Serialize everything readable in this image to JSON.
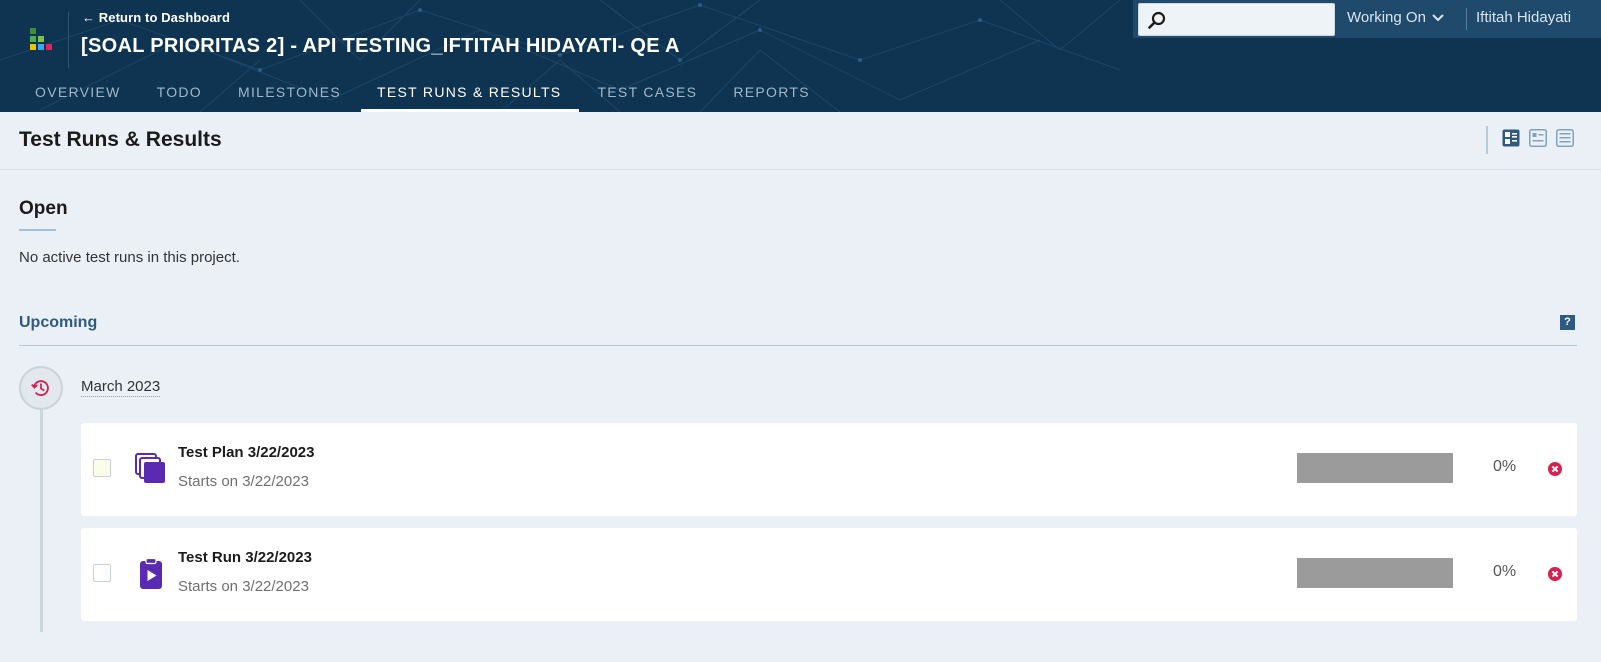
{
  "header": {
    "return_link": "← Return to Dashboard",
    "project_title": "[SOAL PRIORITAS 2] - API TESTING_IFTITAH HIDAYATI- QE A",
    "background_color": "#0f3452",
    "tabs": [
      {
        "label": "OVERVIEW",
        "active": false
      },
      {
        "label": "TODO",
        "active": false
      },
      {
        "label": "MILESTONES",
        "active": false
      },
      {
        "label": "TEST RUNS & RESULTS",
        "active": true
      },
      {
        "label": "TEST CASES",
        "active": false
      },
      {
        "label": "REPORTS",
        "active": false
      }
    ],
    "search": {
      "placeholder": "",
      "value": ""
    },
    "working_on": "Working On",
    "user_name": "Iftitah Hidayati"
  },
  "page": {
    "title": "Test Runs & Results",
    "view_icons": [
      "grouped-view-icon",
      "compact-view-icon",
      "list-view-icon"
    ]
  },
  "open": {
    "heading": "Open",
    "empty_message": "No active test runs in this project."
  },
  "upcoming": {
    "heading": "Upcoming",
    "help_label": "?",
    "month": "March 2023",
    "items": [
      {
        "name": "Test Plan 3/22/2023",
        "subtitle": "Starts on 3/22/2023",
        "percent": "0%",
        "progress": 0,
        "icon": "test-plan-icon"
      },
      {
        "name": "Test Run 3/22/2023",
        "subtitle": "Starts on 3/22/2023",
        "percent": "0%",
        "progress": 0,
        "icon": "test-run-icon"
      }
    ]
  },
  "colors": {
    "accent_purple": "#5a2bb0",
    "delete_red": "#d6204f",
    "progress_gray": "#9b9b9b",
    "link_blue": "#2e5a84"
  }
}
